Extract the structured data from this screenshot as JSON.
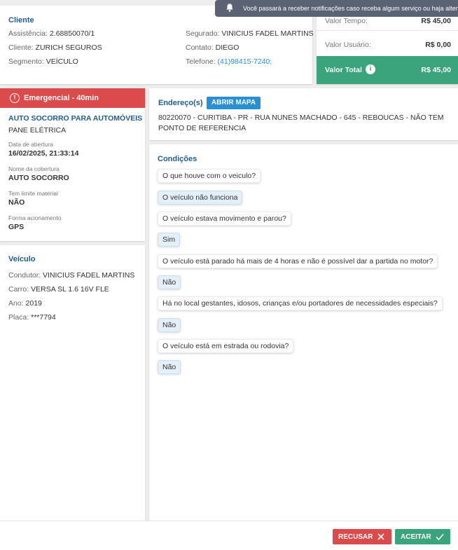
{
  "client": {
    "title": "Cliente",
    "left": [
      {
        "label": "Assistência:",
        "value": "2.68850070/1"
      },
      {
        "label": "Cliente:",
        "value": "ZURICH SEGUROS"
      },
      {
        "label": "Segmento:",
        "value": "VEÍCULO"
      }
    ],
    "right": [
      {
        "label": "Segurado:",
        "value": "VINICIUS FADEL MARTINS"
      },
      {
        "label": "Contato:",
        "value": "DIEGO"
      },
      {
        "label": "Telefone:",
        "value": "(41)98415-7240;"
      }
    ]
  },
  "values": {
    "time_label": "Valor Tempo:",
    "time_value": "R$ 45,00",
    "user_label": "Valor Usuário:",
    "user_value": "R$ 0,00",
    "total_label": "Valor Total",
    "total_value": "R$ 45,00"
  },
  "toast": {
    "text": "Você passará a receber notificações caso receba algum serviço ou haja alteração"
  },
  "service": {
    "badge": "Emergencial - 40min",
    "type": "AUTO SOCORRO PARA AUTOMÓVEIS",
    "problem": "PANE ELÉTRICA",
    "opened_label": "Data de abertura",
    "opened_value": "16/02/2025, 21:33:14",
    "coverage_label": "Nome da cobertura",
    "coverage_value": "AUTO SOCORRO",
    "limit_label": "Tem limite material",
    "limit_value": "NÃO",
    "trigger_label": "Forma acionamento",
    "trigger_value": "GPS"
  },
  "vehicle": {
    "title": "Veículo",
    "rows": [
      {
        "label": "Condutor:",
        "value": "VINICIUS FADEL MARTINS"
      },
      {
        "label": "Carro:",
        "value": "VERSA SL 1.6 16V FLE"
      },
      {
        "label": "Ano:",
        "value": "2019"
      },
      {
        "label": "Placa:",
        "value": "***7794"
      }
    ]
  },
  "address": {
    "title": "Endereço(s)",
    "map_button": "ABRIR MAPA",
    "text": "80220070 - CURITIBA - PR - RUA NUNES MACHADO - 645 - REBOUCAS - NÃO TEM PONTO DE REFERENCIA"
  },
  "conditions": {
    "title": "Condições",
    "items": [
      {
        "question": "O que houve com o veiculo?",
        "answer": "O veículo não funciona"
      },
      {
        "question": "O veículo estava movimento e parou?",
        "answer": "Sim"
      },
      {
        "question": "O veículo está parado há mais de 4 horas e não é possível dar a partida no motor?",
        "answer": "Não"
      },
      {
        "question": "Há no local gestantes, idosos, crianças e/ou portadores de necessidades especiais?",
        "answer": "Não"
      },
      {
        "question": "O veículo está em estrada ou rodovia?",
        "answer": "Não"
      }
    ]
  },
  "footer": {
    "refuse_label": "RECUSAR",
    "accept_label": "ACEITAR"
  },
  "colors": {
    "emergency": "#dc4b4b",
    "total": "#3aa57d",
    "primary": "#2b8fd6",
    "title": "#1f5c8f"
  }
}
